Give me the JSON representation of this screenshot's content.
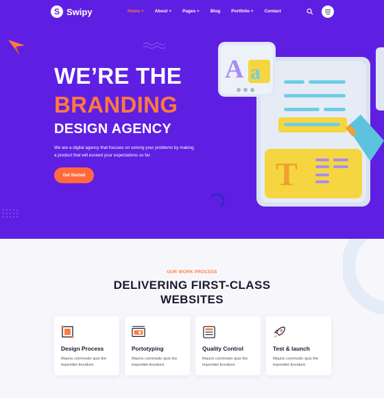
{
  "brand": {
    "name": "Swipy",
    "mark": "S"
  },
  "nav": {
    "items": [
      {
        "label": "Home +",
        "active": true
      },
      {
        "label": "About +",
        "active": false
      },
      {
        "label": "Pages +",
        "active": false
      },
      {
        "label": "Blog",
        "active": false
      },
      {
        "label": "Portfolio +",
        "active": false
      },
      {
        "label": "Contact",
        "active": false
      }
    ],
    "search_icon": "search-icon",
    "menu_icon": "hamburger-icon"
  },
  "hero": {
    "line1": "WE’RE THE",
    "line2": "BRANDING",
    "line3": "DESIGN AGENCY",
    "description": "We are a digital agency that focuses on solving your problems by making a product that will exceed your expectations so far.",
    "cta_label": "Get Started",
    "illustration": {
      "letters_card": "Aa",
      "text_card": "T"
    }
  },
  "process": {
    "label": "OUR WORK PROCESS",
    "title": "DELIVERING FIRST-CLASS WEBSITES",
    "cards": [
      {
        "title": "Design Process",
        "text": "Mauris commodo quis the imperdiet tincidunt.",
        "icon": "design-icon"
      },
      {
        "title": "Portotyping",
        "text": "Mauris commodo quis the imperdiet tincidunt.",
        "icon": "prototype-icon"
      },
      {
        "title": "Quality Control",
        "text": "Mauris commodo quis the imperdiet tincidunt.",
        "icon": "checklist-icon"
      },
      {
        "title": "Test & launch",
        "text": "Mauris commodo quis the imperdiet tincidunt.",
        "icon": "rocket-icon"
      }
    ]
  },
  "colors": {
    "primary": "#5f1fe3",
    "accent": "#ff7a3d",
    "dark": "#1a1a2e"
  }
}
